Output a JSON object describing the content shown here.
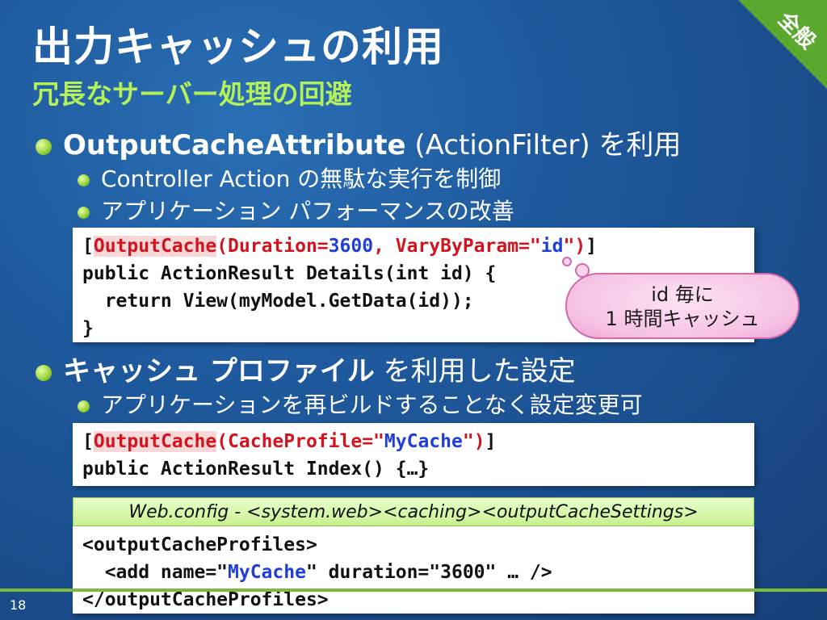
{
  "slide": {
    "title": "出力キャッシュの利用",
    "subtitle": "冗長なサーバー処理の回避",
    "corner_badge": "全般",
    "page_number": "18"
  },
  "bullets": {
    "b1_bold": "OutputCacheAttribute",
    "b1_rest": " (ActionFilter) を利用",
    "b1_sub1": "Controller Action の無駄な実行を制御",
    "b1_sub2": "アプリケーション パフォーマンスの改善",
    "b2_bold": "キャッシュ プロファイル",
    "b2_rest": " を利用した設定",
    "b2_sub1": "アプリケーションを再ビルドすることなく設定変更可"
  },
  "code1": {
    "l1_open": "[",
    "l1_attr": "OutputCache",
    "l1_p1": "(Duration=",
    "l1_v1": "3600",
    "l1_p2": ", VaryByParam=\"",
    "l1_v2": "id",
    "l1_p3": "\")",
    "l1_close": "]",
    "l2": "public ActionResult Details(int id) {",
    "l3": "  return View(myModel.GetData(id));",
    "l4": "}"
  },
  "callout": {
    "line1": "id 毎に",
    "line2": "1 時間キャッシュ"
  },
  "code2": {
    "l1_open": "[",
    "l1_attr": "OutputCache",
    "l1_p1": "(CacheProfile=\"",
    "l1_v1": "MyCache",
    "l1_p2": "\")",
    "l1_close": "]",
    "l2": "public ActionResult Index() {…}"
  },
  "config": {
    "header": "Web.config - <system.web><caching><outputCacheSettings>",
    "l1": "<outputCacheProfiles>",
    "l2_a": "  <add name=\"",
    "l2_v": "MyCache",
    "l2_b": "\" duration=\"3600\" … />",
    "l3": "</outputCacheProfiles>"
  },
  "colors": {
    "title": "#ffffff",
    "subtitle": "#b3f05a",
    "accent_green": "#7dbb3a",
    "code_keyword_red": "#d2141e",
    "code_value_blue": "#1f3fd8"
  }
}
